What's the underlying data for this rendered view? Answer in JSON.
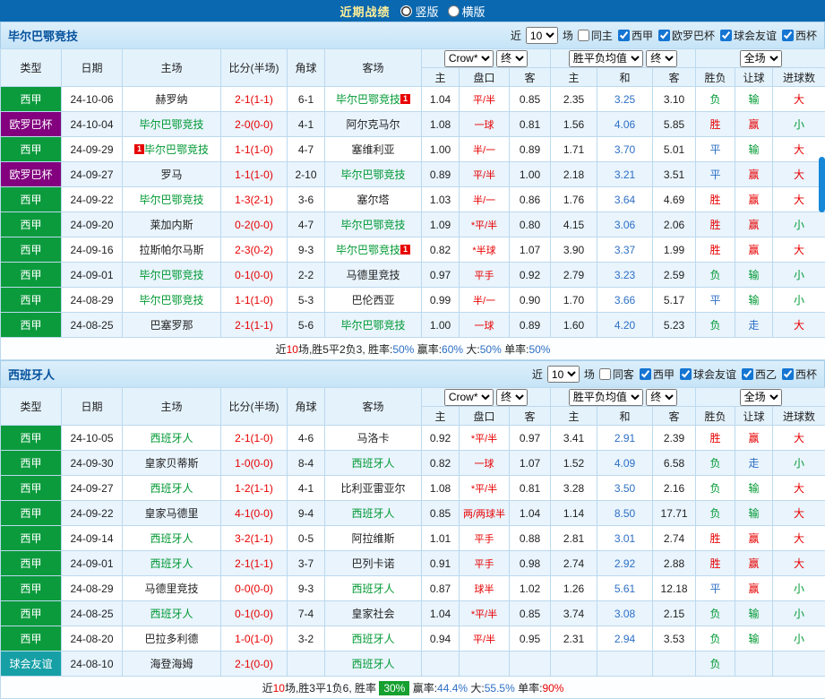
{
  "topbar": {
    "title": "近期战绩",
    "radios": [
      {
        "label": "竖版",
        "selected": true
      },
      {
        "label": "横版",
        "selected": false
      }
    ]
  },
  "table_header": {
    "cols": [
      "类型",
      "日期",
      "主场",
      "比分(半场)",
      "角球",
      "客场"
    ],
    "odds_source": "Crow*",
    "odds_final": "终",
    "avg_source": "胜平负均值",
    "avg_final": "终",
    "scope": "全场",
    "sub": [
      "主",
      "盘口",
      "客",
      "主",
      "和",
      "客",
      "胜负",
      "让球",
      "进球数"
    ]
  },
  "sections": [
    {
      "team": "毕尔巴鄂竞技",
      "filters": {
        "near": "近",
        "count": "10",
        "unit": "场",
        "checkboxes": [
          {
            "label": "同主",
            "checked": false
          },
          {
            "label": "西甲",
            "checked": true
          },
          {
            "label": "欧罗巴杯",
            "checked": true
          },
          {
            "label": "球会友谊",
            "checked": true
          },
          {
            "label": "西杯",
            "checked": true
          }
        ]
      },
      "rows": [
        {
          "league": "西甲",
          "league_type": "liga",
          "date": "24-10-06",
          "home": {
            "name": "赫罗纳",
            "hl": false
          },
          "score": "2-1(1-1)",
          "corners": "6-1",
          "away": {
            "name": "毕尔巴鄂竞技",
            "hl": true,
            "badge": "1",
            "badge_pos": "after"
          },
          "odds": [
            "1.04",
            "平/半",
            "0.85"
          ],
          "avg": [
            "2.35",
            "3.25",
            "3.10"
          ],
          "results": [
            [
              "负",
              "g"
            ],
            [
              "输",
              "g"
            ],
            [
              "大",
              "r"
            ]
          ]
        },
        {
          "league": "欧罗巴杯",
          "league_type": "europa",
          "date": "24-10-04",
          "home": {
            "name": "毕尔巴鄂竞技",
            "hl": true
          },
          "score": "2-0(0-0)",
          "corners": "4-1",
          "away": {
            "name": "阿尔克马尔",
            "hl": false
          },
          "odds": [
            "1.08",
            "一球",
            "0.81"
          ],
          "avg": [
            "1.56",
            "4.06",
            "5.85"
          ],
          "results": [
            [
              "胜",
              "r"
            ],
            [
              "赢",
              "r"
            ],
            [
              "小",
              "g"
            ]
          ]
        },
        {
          "league": "西甲",
          "league_type": "liga",
          "date": "24-09-29",
          "home": {
            "name": "毕尔巴鄂竞技",
            "hl": true,
            "badge": "1",
            "badge_pos": "before"
          },
          "score": "1-1(1-0)",
          "corners": "4-7",
          "away": {
            "name": "塞维利亚",
            "hl": false
          },
          "odds": [
            "1.00",
            "半/一",
            "0.89"
          ],
          "avg": [
            "1.71",
            "3.70",
            "5.01"
          ],
          "results": [
            [
              "平",
              "b"
            ],
            [
              "输",
              "g"
            ],
            [
              "大",
              "r"
            ]
          ]
        },
        {
          "league": "欧罗巴杯",
          "league_type": "europa",
          "date": "24-09-27",
          "home": {
            "name": "罗马",
            "hl": false
          },
          "score": "1-1(1-0)",
          "corners": "2-10",
          "away": {
            "name": "毕尔巴鄂竞技",
            "hl": true
          },
          "odds": [
            "0.89",
            "平/半",
            "1.00"
          ],
          "avg": [
            "2.18",
            "3.21",
            "3.51"
          ],
          "results": [
            [
              "平",
              "b"
            ],
            [
              "赢",
              "r"
            ],
            [
              "大",
              "r"
            ]
          ]
        },
        {
          "league": "西甲",
          "league_type": "liga",
          "date": "24-09-22",
          "home": {
            "name": "毕尔巴鄂竞技",
            "hl": true
          },
          "score": "1-3(2-1)",
          "corners": "3-6",
          "away": {
            "name": "塞尔塔",
            "hl": false
          },
          "odds": [
            "1.03",
            "半/一",
            "0.86"
          ],
          "avg": [
            "1.76",
            "3.64",
            "4.69"
          ],
          "results": [
            [
              "胜",
              "r"
            ],
            [
              "赢",
              "r"
            ],
            [
              "大",
              "r"
            ]
          ]
        },
        {
          "league": "西甲",
          "league_type": "liga",
          "date": "24-09-20",
          "home": {
            "name": "莱加内斯",
            "hl": false
          },
          "score": "0-2(0-0)",
          "corners": "4-7",
          "away": {
            "name": "毕尔巴鄂竞技",
            "hl": true
          },
          "odds": [
            "1.09",
            "*平/半",
            "0.80"
          ],
          "avg": [
            "4.15",
            "3.06",
            "2.06"
          ],
          "results": [
            [
              "胜",
              "r"
            ],
            [
              "赢",
              "r"
            ],
            [
              "小",
              "g"
            ]
          ]
        },
        {
          "league": "西甲",
          "league_type": "liga",
          "date": "24-09-16",
          "home": {
            "name": "拉斯帕尔马斯",
            "hl": false
          },
          "score": "2-3(0-2)",
          "corners": "9-3",
          "away": {
            "name": "毕尔巴鄂竞技",
            "hl": true,
            "badge": "1",
            "badge_pos": "after"
          },
          "odds": [
            "0.82",
            "*半球",
            "1.07"
          ],
          "avg": [
            "3.90",
            "3.37",
            "1.99"
          ],
          "results": [
            [
              "胜",
              "r"
            ],
            [
              "赢",
              "r"
            ],
            [
              "大",
              "r"
            ]
          ]
        },
        {
          "league": "西甲",
          "league_type": "liga",
          "date": "24-09-01",
          "home": {
            "name": "毕尔巴鄂竞技",
            "hl": true
          },
          "score": "0-1(0-0)",
          "corners": "2-2",
          "away": {
            "name": "马德里竞技",
            "hl": false
          },
          "odds": [
            "0.97",
            "平手",
            "0.92"
          ],
          "avg": [
            "2.79",
            "3.23",
            "2.59"
          ],
          "results": [
            [
              "负",
              "g"
            ],
            [
              "输",
              "g"
            ],
            [
              "小",
              "g"
            ]
          ]
        },
        {
          "league": "西甲",
          "league_type": "liga",
          "date": "24-08-29",
          "home": {
            "name": "毕尔巴鄂竞技",
            "hl": true
          },
          "score": "1-1(1-0)",
          "corners": "5-3",
          "away": {
            "name": "巴伦西亚",
            "hl": false
          },
          "odds": [
            "0.99",
            "半/一",
            "0.90"
          ],
          "avg": [
            "1.70",
            "3.66",
            "5.17"
          ],
          "results": [
            [
              "平",
              "b"
            ],
            [
              "输",
              "g"
            ],
            [
              "小",
              "g"
            ]
          ]
        },
        {
          "league": "西甲",
          "league_type": "liga",
          "date": "24-08-25",
          "home": {
            "name": "巴塞罗那",
            "hl": false
          },
          "score": "2-1(1-1)",
          "corners": "5-6",
          "away": {
            "name": "毕尔巴鄂竞技",
            "hl": true
          },
          "odds": [
            "1.00",
            "一球",
            "0.89"
          ],
          "avg": [
            "1.60",
            "4.20",
            "5.23"
          ],
          "results": [
            [
              "负",
              "g"
            ],
            [
              "走",
              "b"
            ],
            [
              "大",
              "r"
            ]
          ]
        }
      ],
      "summary": [
        [
          "近",
          "k"
        ],
        [
          "10",
          "r"
        ],
        [
          "场,胜5平2负3, 胜率:",
          "k"
        ],
        [
          "50%",
          "b"
        ],
        [
          "  赢率:",
          "k"
        ],
        [
          "60%",
          "b"
        ],
        [
          "  大:",
          "k"
        ],
        [
          "50%",
          "b"
        ],
        [
          "  单率:",
          "k"
        ],
        [
          "50%",
          "b"
        ]
      ]
    },
    {
      "team": "西班牙人",
      "filters": {
        "near": "近",
        "count": "10",
        "unit": "场",
        "checkboxes": [
          {
            "label": "同客",
            "checked": false
          },
          {
            "label": "西甲",
            "checked": true
          },
          {
            "label": "球会友谊",
            "checked": true
          },
          {
            "label": "西乙",
            "checked": true
          },
          {
            "label": "西杯",
            "checked": true
          }
        ]
      },
      "rows": [
        {
          "league": "西甲",
          "league_type": "liga",
          "date": "24-10-05",
          "home": {
            "name": "西班牙人",
            "hl": true
          },
          "score": "2-1(1-0)",
          "corners": "4-6",
          "away": {
            "name": "马洛卡",
            "hl": false
          },
          "odds": [
            "0.92",
            "*平/半",
            "0.97"
          ],
          "avg": [
            "3.41",
            "2.91",
            "2.39"
          ],
          "results": [
            [
              "胜",
              "r"
            ],
            [
              "赢",
              "r"
            ],
            [
              "大",
              "r"
            ]
          ]
        },
        {
          "league": "西甲",
          "league_type": "liga",
          "date": "24-09-30",
          "home": {
            "name": "皇家贝蒂斯",
            "hl": false
          },
          "score": "1-0(0-0)",
          "corners": "8-4",
          "away": {
            "name": "西班牙人",
            "hl": true
          },
          "odds": [
            "0.82",
            "一球",
            "1.07"
          ],
          "avg": [
            "1.52",
            "4.09",
            "6.58"
          ],
          "results": [
            [
              "负",
              "g"
            ],
            [
              "走",
              "b"
            ],
            [
              "小",
              "g"
            ]
          ]
        },
        {
          "league": "西甲",
          "league_type": "liga",
          "date": "24-09-27",
          "home": {
            "name": "西班牙人",
            "hl": true
          },
          "score": "1-2(1-1)",
          "corners": "4-1",
          "away": {
            "name": "比利亚雷亚尔",
            "hl": false
          },
          "odds": [
            "1.08",
            "*平/半",
            "0.81"
          ],
          "avg": [
            "3.28",
            "3.50",
            "2.16"
          ],
          "results": [
            [
              "负",
              "g"
            ],
            [
              "输",
              "g"
            ],
            [
              "大",
              "r"
            ]
          ]
        },
        {
          "league": "西甲",
          "league_type": "liga",
          "date": "24-09-22",
          "home": {
            "name": "皇家马德里",
            "hl": false
          },
          "score": "4-1(0-0)",
          "corners": "9-4",
          "away": {
            "name": "西班牙人",
            "hl": true
          },
          "odds": [
            "0.85",
            "两/两球半",
            "1.04"
          ],
          "avg": [
            "1.14",
            "8.50",
            "17.71"
          ],
          "results": [
            [
              "负",
              "g"
            ],
            [
              "输",
              "g"
            ],
            [
              "大",
              "r"
            ]
          ]
        },
        {
          "league": "西甲",
          "league_type": "liga",
          "date": "24-09-14",
          "home": {
            "name": "西班牙人",
            "hl": true
          },
          "score": "3-2(1-1)",
          "corners": "0-5",
          "away": {
            "name": "阿拉维斯",
            "hl": false
          },
          "odds": [
            "1.01",
            "平手",
            "0.88"
          ],
          "avg": [
            "2.81",
            "3.01",
            "2.74"
          ],
          "results": [
            [
              "胜",
              "r"
            ],
            [
              "赢",
              "r"
            ],
            [
              "大",
              "r"
            ]
          ]
        },
        {
          "league": "西甲",
          "league_type": "liga",
          "date": "24-09-01",
          "home": {
            "name": "西班牙人",
            "hl": true
          },
          "score": "2-1(1-1)",
          "corners": "3-7",
          "away": {
            "name": "巴列卡诺",
            "hl": false
          },
          "odds": [
            "0.91",
            "平手",
            "0.98"
          ],
          "avg": [
            "2.74",
            "2.92",
            "2.88"
          ],
          "results": [
            [
              "胜",
              "r"
            ],
            [
              "赢",
              "r"
            ],
            [
              "大",
              "r"
            ]
          ]
        },
        {
          "league": "西甲",
          "league_type": "liga",
          "date": "24-08-29",
          "home": {
            "name": "马德里竞技",
            "hl": false
          },
          "score": "0-0(0-0)",
          "corners": "9-3",
          "away": {
            "name": "西班牙人",
            "hl": true
          },
          "odds": [
            "0.87",
            "球半",
            "1.02"
          ],
          "avg": [
            "1.26",
            "5.61",
            "12.18"
          ],
          "results": [
            [
              "平",
              "b"
            ],
            [
              "赢",
              "r"
            ],
            [
              "小",
              "g"
            ]
          ]
        },
        {
          "league": "西甲",
          "league_type": "liga",
          "date": "24-08-25",
          "home": {
            "name": "西班牙人",
            "hl": true
          },
          "score": "0-1(0-0)",
          "corners": "7-4",
          "away": {
            "name": "皇家社会",
            "hl": false
          },
          "odds": [
            "1.04",
            "*平/半",
            "0.85"
          ],
          "avg": [
            "3.74",
            "3.08",
            "2.15"
          ],
          "results": [
            [
              "负",
              "g"
            ],
            [
              "输",
              "g"
            ],
            [
              "小",
              "g"
            ]
          ]
        },
        {
          "league": "西甲",
          "league_type": "liga",
          "date": "24-08-20",
          "home": {
            "name": "巴拉多利德",
            "hl": false
          },
          "score": "1-0(1-0)",
          "corners": "3-2",
          "away": {
            "name": "西班牙人",
            "hl": true
          },
          "odds": [
            "0.94",
            "平/半",
            "0.95"
          ],
          "avg": [
            "2.31",
            "2.94",
            "3.53"
          ],
          "results": [
            [
              "负",
              "g"
            ],
            [
              "输",
              "g"
            ],
            [
              "小",
              "g"
            ]
          ]
        },
        {
          "league": "球会友谊",
          "league_type": "friendly",
          "date": "24-08-10",
          "home": {
            "name": "海登海姆",
            "hl": false
          },
          "score": "2-1(0-0)",
          "corners": "",
          "away": {
            "name": "西班牙人",
            "hl": true
          },
          "odds": [
            "",
            "",
            ""
          ],
          "avg": [
            "",
            "",
            ""
          ],
          "results": [
            [
              "负",
              "g"
            ],
            [
              "",
              ""
            ],
            [
              "",
              ""
            ]
          ]
        }
      ],
      "summary": [
        [
          "近",
          "k"
        ],
        [
          "10",
          "r"
        ],
        [
          "场,胜3平1负6, 胜率 ",
          "k"
        ],
        [
          "30%",
          "badge"
        ],
        [
          "  赢率:",
          "k"
        ],
        [
          "44.4%",
          "b"
        ],
        [
          "  大:",
          "k"
        ],
        [
          "55.5%",
          "b"
        ],
        [
          "  单率:",
          "k"
        ],
        [
          "90%",
          "r"
        ]
      ]
    }
  ]
}
